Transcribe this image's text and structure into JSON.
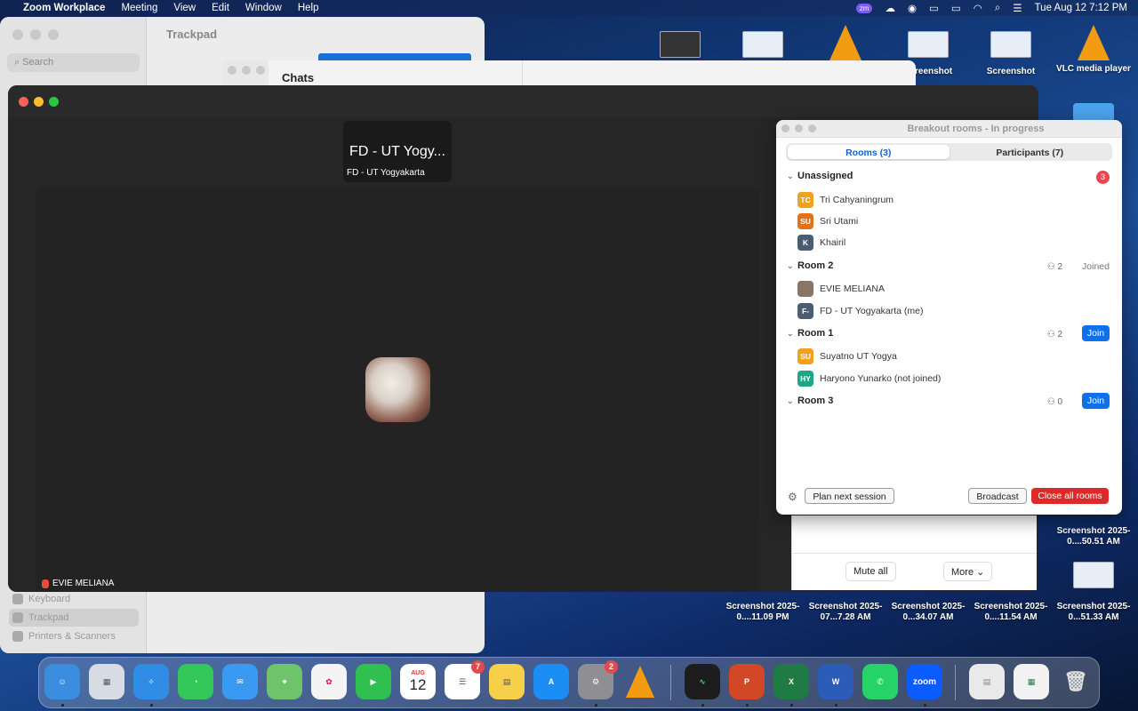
{
  "menubar": {
    "app_name": "Zoom Workplace",
    "menus": [
      "Meeting",
      "View",
      "Edit",
      "Window",
      "Help"
    ],
    "clock": "Tue Aug 12  7:12 PM",
    "zm_badge": "zm"
  },
  "desktop": {
    "icons": [
      {
        "label": "Screenshot 2025-0....11.09 PM"
      },
      {
        "label": "Screenshot 2025-07...7.28 AM"
      },
      {
        "label": "Screenshot 2025-0...34.07 AM"
      },
      {
        "label": "Screenshot 2025-0....11.54 AM"
      },
      {
        "label": "Screenshot 2025-0...51.33 AM"
      },
      {
        "label": "Screenshot 2025-0....50.51 AM"
      },
      {
        "label": "VLC media player"
      },
      {
        "label": "Screenshot"
      },
      {
        "label": "Screenshot"
      }
    ]
  },
  "settings": {
    "title": "Trackpad",
    "search_placeholder": "Search",
    "sidebar": [
      {
        "label": "Keyboard"
      },
      {
        "label": "Trackpad"
      },
      {
        "label": "Printers & Scanners"
      }
    ]
  },
  "chats": {
    "title": "Chats"
  },
  "meeting": {
    "small_tile_name_big": "FD - UT Yogy...",
    "small_tile_name_small": "FD - UT Yogyakarta",
    "active_speaker": "EVIE MELIANA"
  },
  "participants_panel": {
    "mute_all": "Mute all",
    "more": "More"
  },
  "breakout": {
    "title": "Breakout rooms - In progress",
    "tabs": [
      {
        "label": "Rooms (3)",
        "active": true
      },
      {
        "label": "Participants (7)",
        "active": false
      }
    ],
    "rooms": [
      {
        "name": "Unassigned",
        "badge": "3",
        "members": [
          {
            "initials": "TC",
            "name": "Tri Cahyaningrum",
            "color": "#f0a21c"
          },
          {
            "initials": "SU",
            "name": "Sri Utami",
            "color": "#e0721a"
          },
          {
            "initials": "K",
            "name": "Khairil",
            "color": "#4b5d72"
          }
        ]
      },
      {
        "name": "Room 2",
        "count": "2",
        "status": "Joined",
        "members": [
          {
            "initials": "",
            "name": "EVIE MELIANA",
            "color": "#8a7466"
          },
          {
            "initials": "F-",
            "name": "FD - UT Yogyakarta (me)",
            "color": "#4b5d72"
          }
        ]
      },
      {
        "name": "Room 1",
        "count": "2",
        "action": "Join",
        "members": [
          {
            "initials": "SU",
            "name": "Suyatno UT Yogya",
            "color": "#f0a21c"
          },
          {
            "initials": "HY",
            "name": "Haryono Yunarko (not joined)",
            "color": "#1fa58a"
          }
        ]
      },
      {
        "name": "Room 3",
        "count": "0",
        "action": "Join",
        "members": []
      }
    ],
    "plan_next_session": "Plan next session",
    "broadcast": "Broadcast",
    "close_all": "Close all rooms"
  },
  "dock": {
    "calendar_month": "AUG",
    "calendar_day": "12",
    "reminders_badge": "7",
    "settings_badge": "2",
    "zoom_label": "zoom"
  },
  "colors": {
    "accent": "#0e71eb",
    "danger": "#e02828",
    "badge": "#e5484d"
  }
}
